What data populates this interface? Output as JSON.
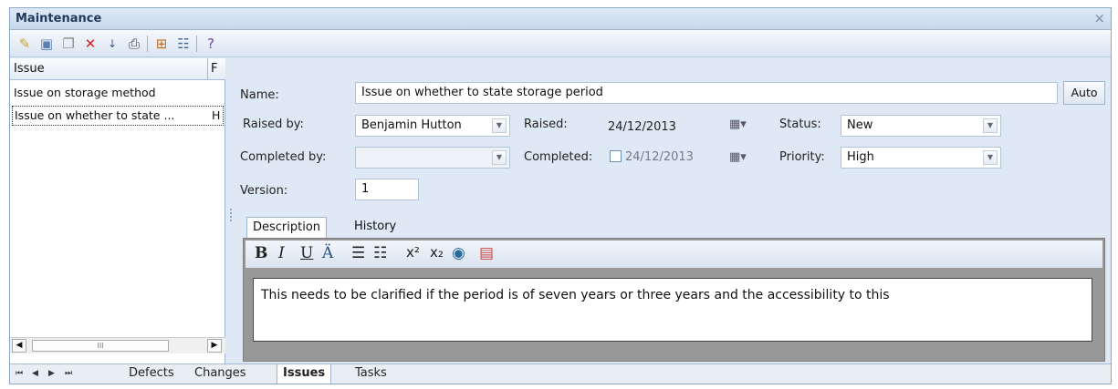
{
  "window": {
    "title": "Maintenance",
    "close_glyph": "×"
  },
  "toolbar": {
    "icons": [
      "new-icon",
      "save-icon",
      "copy-icon",
      "delete-icon",
      "sort-icon",
      "print-icon",
      "hierarchy-icon",
      "properties-icon",
      "help-icon"
    ]
  },
  "list": {
    "columns": [
      "Issue",
      "F"
    ],
    "rows": [
      {
        "issue": "Issue on storage method",
        "flag": ""
      },
      {
        "issue": "Issue on whether to state ...",
        "flag": "H"
      }
    ],
    "scroll_thumb": "III"
  },
  "form": {
    "name_label": "Name:",
    "name_value": "Issue on whether to state storage period",
    "auto_label": "Auto",
    "raised_by_label": "Raised by:",
    "raised_by_value": "Benjamin Hutton",
    "raised_label": "Raised:",
    "raised_value": "24/12/2013",
    "status_label": "Status:",
    "status_value": "New",
    "completed_by_label": "Completed by:",
    "completed_by_value": "",
    "completed_label": "Completed:",
    "completed_value": "24/12/2013",
    "priority_label": "Priority:",
    "priority_value": "High",
    "version_label": "Version:",
    "version_value": "1"
  },
  "tabs": [
    "Description",
    "History"
  ],
  "editor": {
    "text": "This needs to be clarified if the period is of seven years or three years and the accessibility to this",
    "tools": {
      "bold": "B",
      "italic": "I",
      "underline": "U"
    }
  },
  "bottom_tabs": [
    "Defects",
    "Changes",
    "Issues",
    "Tasks"
  ],
  "colors": {
    "accent": "#1e395b",
    "chrome": "#dfe9f5"
  }
}
